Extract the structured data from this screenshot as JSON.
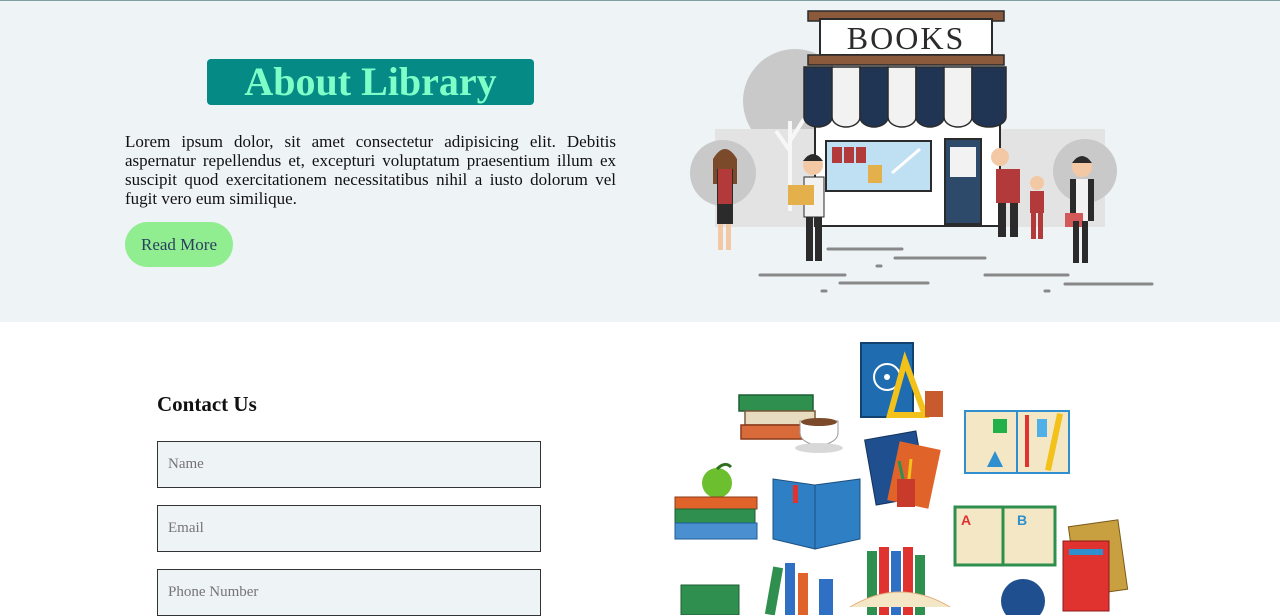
{
  "about": {
    "title": "About Library",
    "text": "Lorem ipsum dolor, sit amet consectetur adipisicing elit. Debitis aspernatur repellendus et, excepturi voluptatum praesentium illum ex suscipit quod exercitationem necessitatibus nihil a iusto dolorum vel fugit vero eum similique.",
    "read_more": "Read More",
    "sign": "BOOKS"
  },
  "contact": {
    "title": "Contact Us",
    "name_placeholder": "Name",
    "email_placeholder": "Email",
    "phone_placeholder": "Phone Number"
  },
  "colors": {
    "about_bg": "#eef3f6",
    "title_bg": "#058a86",
    "title_text": "#7fffc8",
    "button_bg": "#90ee90",
    "button_text": "#2a3f60"
  },
  "icons": {
    "about_image": "bookstore-illustration",
    "contact_image": "books-collection-illustration"
  }
}
